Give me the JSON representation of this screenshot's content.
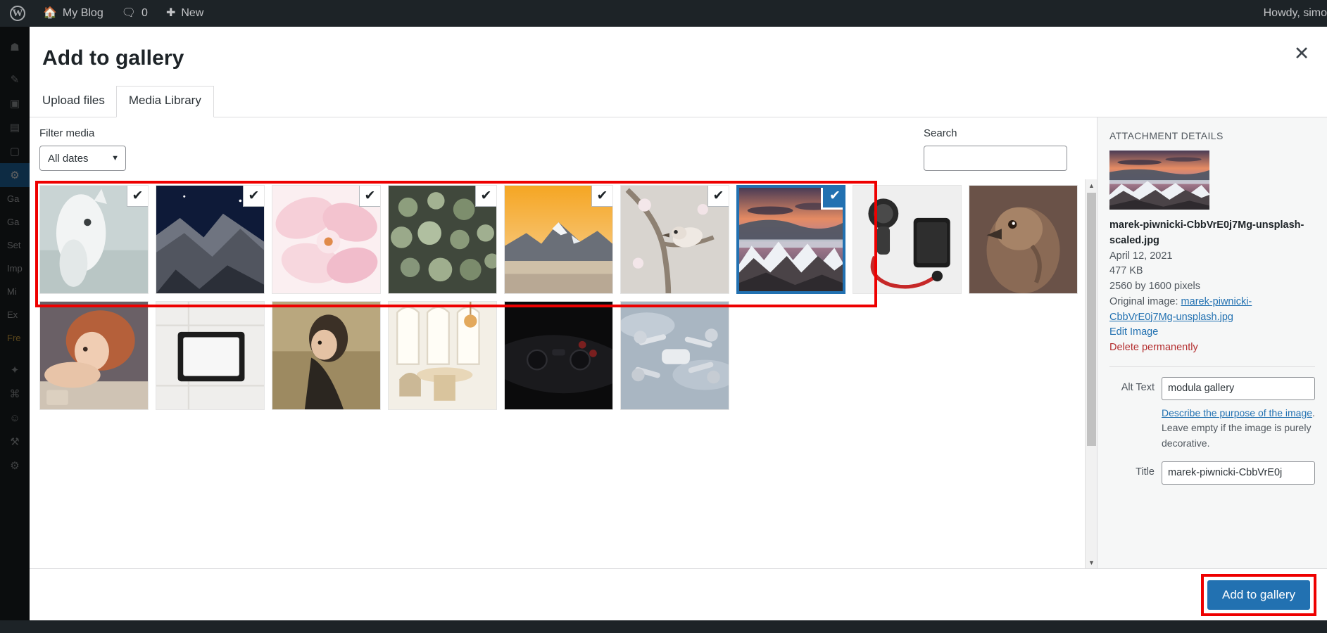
{
  "adminbar": {
    "logo_icon": "wordpress-logo-icon",
    "home_icon": "home-icon",
    "site_name": "My Blog",
    "comments_icon": "comment-bubble-icon",
    "comments_count": "0",
    "new_icon": "plus-icon",
    "new_label": "New",
    "account_greeting": "Howdy, simo"
  },
  "adminmenu": {
    "icons": [
      {
        "name": "dashboard-icon",
        "glyph": "⌂"
      },
      {
        "name": "posts-icon",
        "glyph": "✎"
      },
      {
        "name": "media-icon",
        "glyph": "▣"
      },
      {
        "name": "pages-icon",
        "glyph": "▤"
      },
      {
        "name": "comments-icon",
        "glyph": "▢"
      },
      {
        "name": "modula-icon",
        "glyph": "⚙"
      }
    ],
    "submenu": [
      {
        "label": "Ga",
        "highlight": false
      },
      {
        "label": "Ga",
        "highlight": false
      },
      {
        "label": "Set",
        "highlight": false
      },
      {
        "label": "Imp",
        "highlight": false
      },
      {
        "label": "Mi",
        "highlight": false
      },
      {
        "label": "Ex",
        "highlight": false
      },
      {
        "label": "Fre",
        "highlight": true
      }
    ],
    "bottom_icons": [
      {
        "name": "appearance-icon",
        "glyph": "✦"
      },
      {
        "name": "plugins-icon",
        "glyph": "⌘"
      },
      {
        "name": "users-icon",
        "glyph": "☺"
      },
      {
        "name": "tools-icon",
        "glyph": "⚒"
      },
      {
        "name": "settings-icon",
        "glyph": "⚙"
      }
    ]
  },
  "modal": {
    "title": "Add to gallery",
    "close_icon": "close-icon",
    "tabs": [
      {
        "label": "Upload files",
        "active": false
      },
      {
        "label": "Media Library",
        "active": true
      }
    ]
  },
  "toolbar": {
    "filter_label": "Filter media",
    "date_filter_value": "All dates",
    "date_filter_icon": "chevron-down-icon",
    "search_label": "Search",
    "search_value": "",
    "search_placeholder": ""
  },
  "grid": {
    "checkmark_glyph": "✔",
    "items": [
      {
        "alt": "white horse portrait",
        "checked": true,
        "selected": false,
        "art": "horse"
      },
      {
        "alt": "el capitan granite cliff at night",
        "checked": true,
        "selected": false,
        "art": "cliff"
      },
      {
        "alt": "pink magnolia blossom",
        "checked": true,
        "selected": false,
        "art": "blossom"
      },
      {
        "alt": "green succulent plant close-up",
        "checked": true,
        "selected": false,
        "art": "succulent"
      },
      {
        "alt": "mountain lake at orange sunset",
        "checked": true,
        "selected": false,
        "art": "sunsetlake"
      },
      {
        "alt": "small bird on blossoming branch",
        "checked": true,
        "selected": false,
        "art": "bird"
      },
      {
        "alt": "snowy mountains under pink clouds",
        "checked": true,
        "selected": true,
        "art": "marek"
      },
      {
        "alt": "smartwatch phone and earphones flat lay",
        "checked": false,
        "selected": false,
        "art": "gadgets"
      },
      {
        "alt": "brown hawk portrait",
        "checked": false,
        "selected": false,
        "art": "hawk"
      },
      {
        "alt": "red haired woman resting on table",
        "checked": false,
        "selected": false,
        "art": "woman"
      },
      {
        "alt": "tablet on white tiled surface",
        "checked": false,
        "selected": false,
        "art": "tablet"
      },
      {
        "alt": "woman in field at golden hour",
        "checked": false,
        "selected": false,
        "art": "field"
      },
      {
        "alt": "bright dining room with arched windows",
        "checked": false,
        "selected": false,
        "art": "interior"
      },
      {
        "alt": "black game controller close-up",
        "checked": false,
        "selected": false,
        "art": "controller"
      },
      {
        "alt": "white drone flying in cloudy sky",
        "checked": false,
        "selected": false,
        "art": "drone"
      }
    ],
    "scrollbar": {
      "up_arrow_icon": "scroll-up-arrow-icon",
      "down_arrow_icon": "scroll-down-arrow-icon"
    }
  },
  "details": {
    "heading": "ATTACHMENT DETAILS",
    "preview_alt": "snowy mountains under pink clouds",
    "filename": "marek-piwnicki-CbbVrE0j7Mg-unsplash-scaled.jpg",
    "date": "April 12, 2021",
    "filesize": "477 KB",
    "dimensions": "2560 by 1600 pixels",
    "original_label": "Original image:",
    "original_link": "marek-piwnicki-CbbVrE0j7Mg-unsplash.jpg",
    "edit_image_label": "Edit Image",
    "delete_label": "Delete permanently",
    "alt_text_label": "Alt Text",
    "alt_text_value": "modula gallery",
    "alt_help_link": "Describe the purpose of the image",
    "alt_help_rest": ". Leave empty if the image is purely decorative.",
    "title_label": "Title",
    "title_value": "marek-piwnicki-CbbVrE0j"
  },
  "footer": {
    "primary_button": "Add to gallery"
  },
  "colors": {
    "accent": "#2271b1",
    "annotation": "#ee0000",
    "danger": "#b32d2e",
    "admin_dark": "#1d2327"
  }
}
